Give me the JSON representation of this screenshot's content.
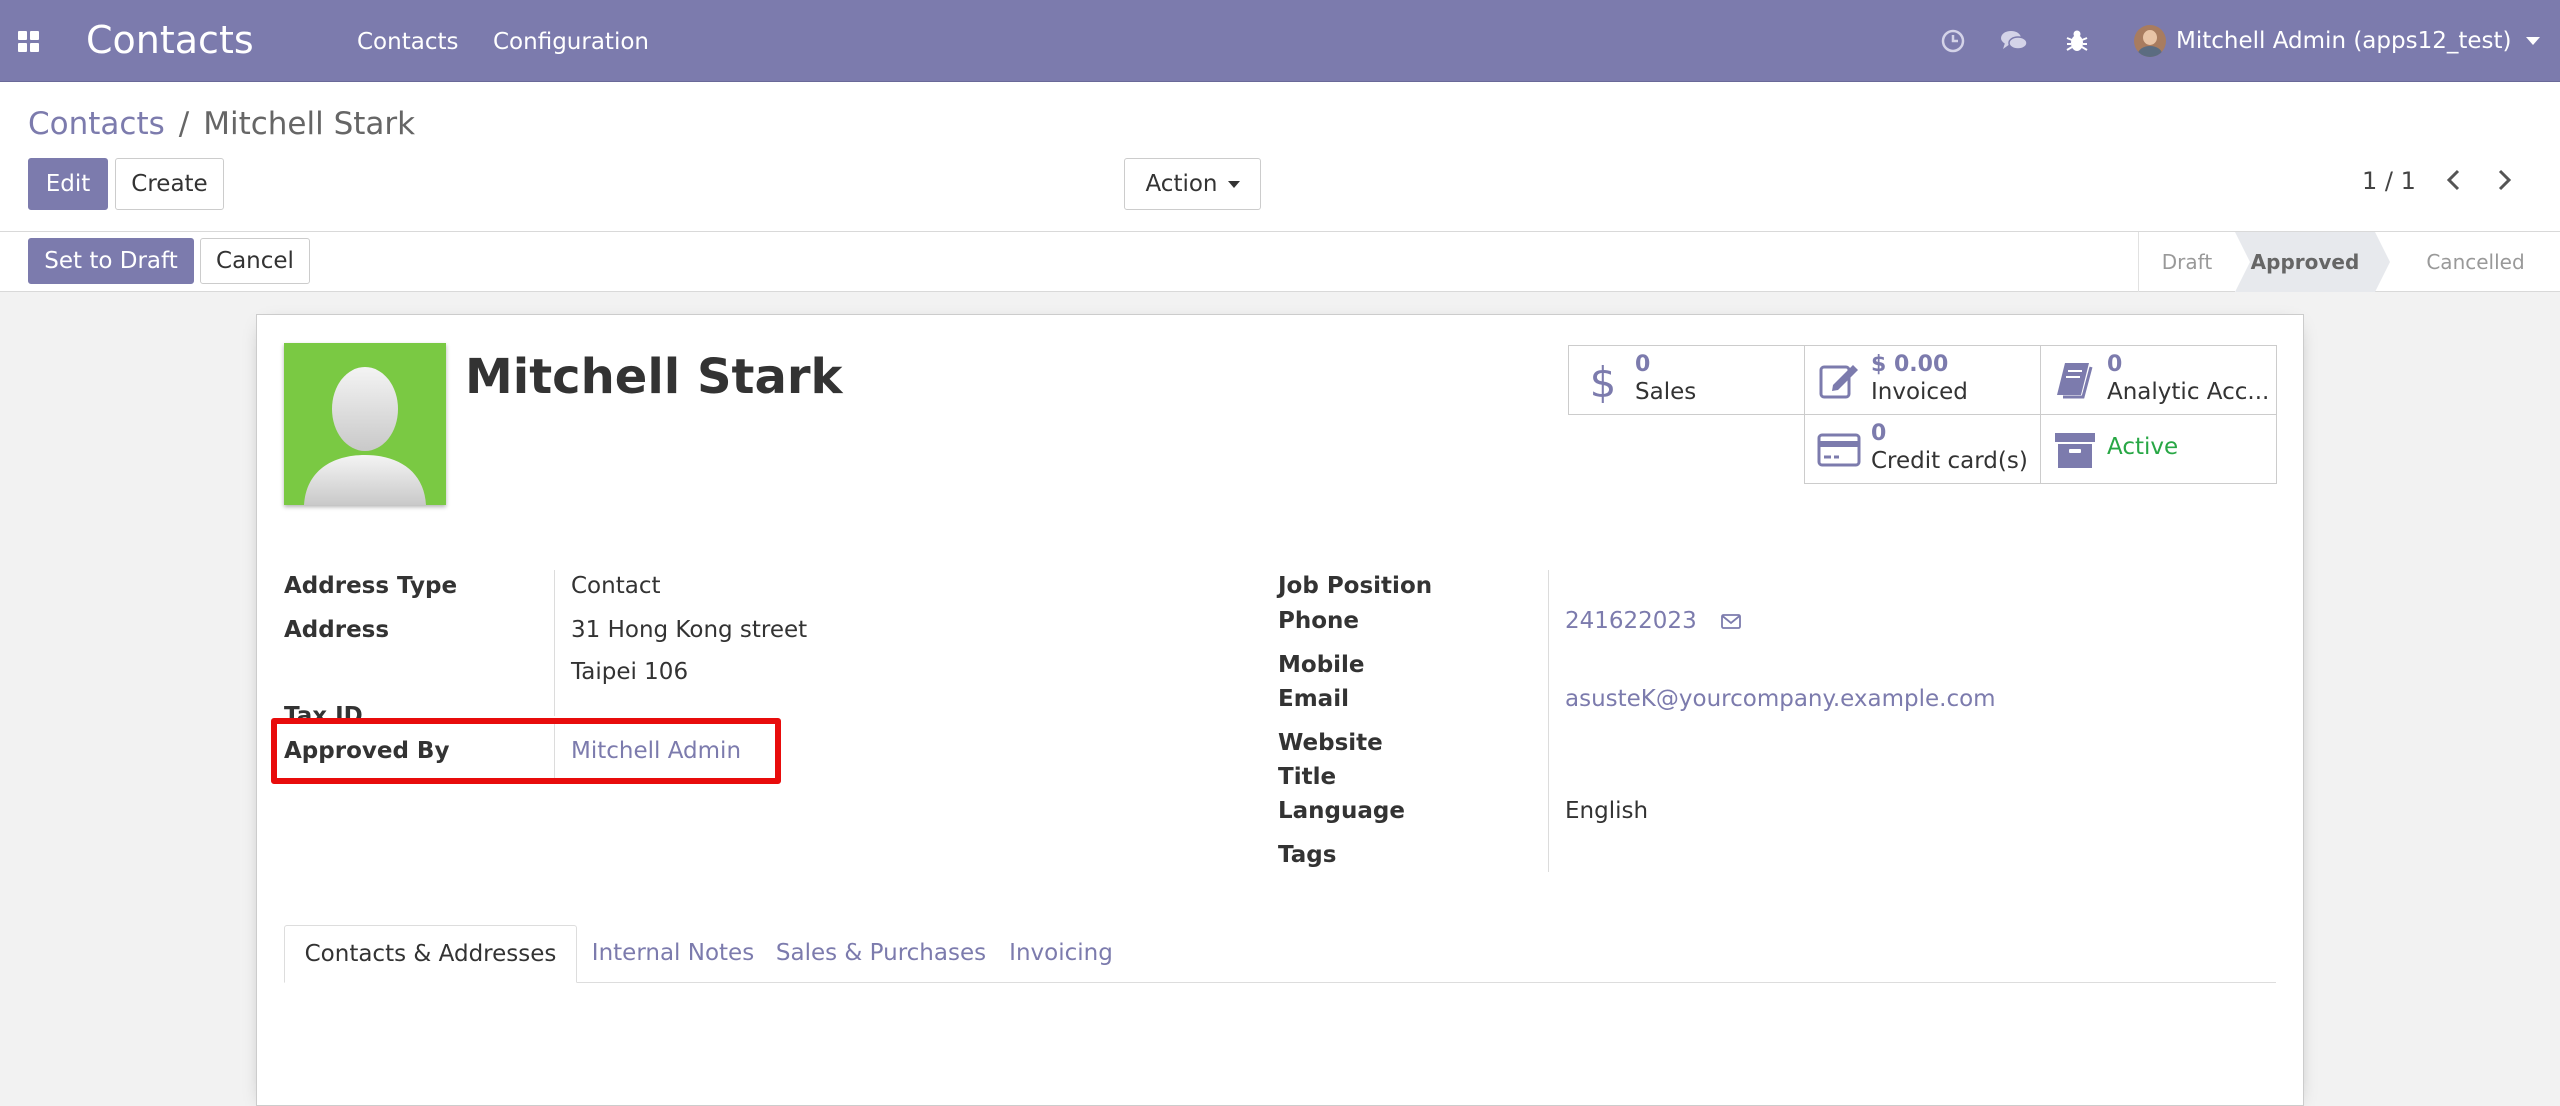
{
  "navbar": {
    "brand": "Contacts",
    "menu": [
      "Contacts",
      "Configuration"
    ],
    "icons": [
      "clock-icon",
      "chat-icon",
      "bug-icon"
    ],
    "user": "Mitchell Admin (apps12_test)"
  },
  "breadcrumb": {
    "parent": "Contacts",
    "separator": "/",
    "current": "Mitchell Stark"
  },
  "buttons": {
    "edit": "Edit",
    "create": "Create",
    "action": "Action",
    "set_to_draft": "Set to Draft",
    "cancel": "Cancel"
  },
  "pager": {
    "value": "1 / 1"
  },
  "status": {
    "stages": [
      "Draft",
      "Approved",
      "Cancelled"
    ],
    "current": "Approved"
  },
  "partner": {
    "name": "Mitchell Stark"
  },
  "smart_buttons": {
    "sales": {
      "value": "0",
      "label": "Sales"
    },
    "invoiced": {
      "value": "$ 0.00",
      "label": "Invoiced"
    },
    "analytic": {
      "value": "0",
      "label": "Analytic Acc..."
    },
    "credit_cards": {
      "value": "0",
      "label": "Credit card(s)"
    },
    "active": {
      "label": "Active"
    }
  },
  "fields_left": {
    "address_type": {
      "label": "Address Type",
      "value": "Contact"
    },
    "address": {
      "label": "Address",
      "street": "31 Hong Kong street",
      "city": "Taipei  106"
    },
    "tax_id": {
      "label": "Tax ID",
      "value": ""
    },
    "approved_by": {
      "label": "Approved By",
      "value": "Mitchell Admin"
    }
  },
  "fields_right": {
    "job_position": {
      "label": "Job Position",
      "value": ""
    },
    "phone": {
      "label": "Phone",
      "value": "241622023"
    },
    "mobile": {
      "label": "Mobile",
      "value": ""
    },
    "email": {
      "label": "Email",
      "value": "asusteK@yourcompany.example.com"
    },
    "website": {
      "label": "Website",
      "value": ""
    },
    "title": {
      "label": "Title",
      "value": ""
    },
    "language": {
      "label": "Language",
      "value": "English"
    },
    "tags": {
      "label": "Tags",
      "value": ""
    }
  },
  "tabs": [
    "Contacts & Addresses",
    "Internal Notes",
    "Sales & Purchases",
    "Invoicing"
  ],
  "active_tab": "Contacts & Addresses",
  "colors": {
    "brand": "#7c7bad",
    "highlight": "#e80c0c",
    "active": "#28a745",
    "photo_bg": "#7ac943"
  }
}
